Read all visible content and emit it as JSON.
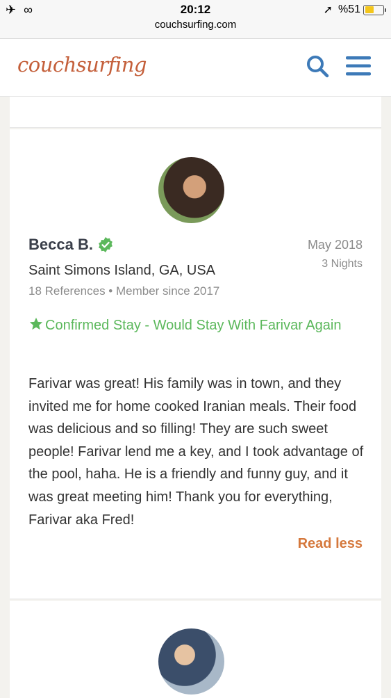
{
  "status_bar": {
    "time": "20:12",
    "url": "couchsurfing.com",
    "battery": "%51",
    "battery_level": 0.51,
    "left_icons": [
      "airplane-icon",
      "link-icon"
    ]
  },
  "header": {
    "logo": "couchsurfing",
    "icons": [
      "search-icon",
      "menu-icon"
    ],
    "accent_color": "#3d7ab8",
    "logo_color": "#c45f3a"
  },
  "reference": {
    "name": "Becca B.",
    "verified": true,
    "date": "May 2018",
    "nights": "3 Nights",
    "location": "Saint Simons Island, GA, USA",
    "meta": "18 References • Member since 2017",
    "confirmed": "Confirmed Stay - Would Stay With Farivar Again",
    "body": "Farivar was great! His family was in town, and they invited me for home cooked Iranian meals. Their food was delicious and so filling! They are such sweet people! Farivar lend me a key, and I took advantage of the pool, haha. He is a friendly and funny guy, and it was great meeting him! Thank you for everything, Farivar aka Fred!",
    "read_less": "Read less",
    "colors": {
      "confirmed": "#5cb85c",
      "link": "#d5783c"
    }
  }
}
